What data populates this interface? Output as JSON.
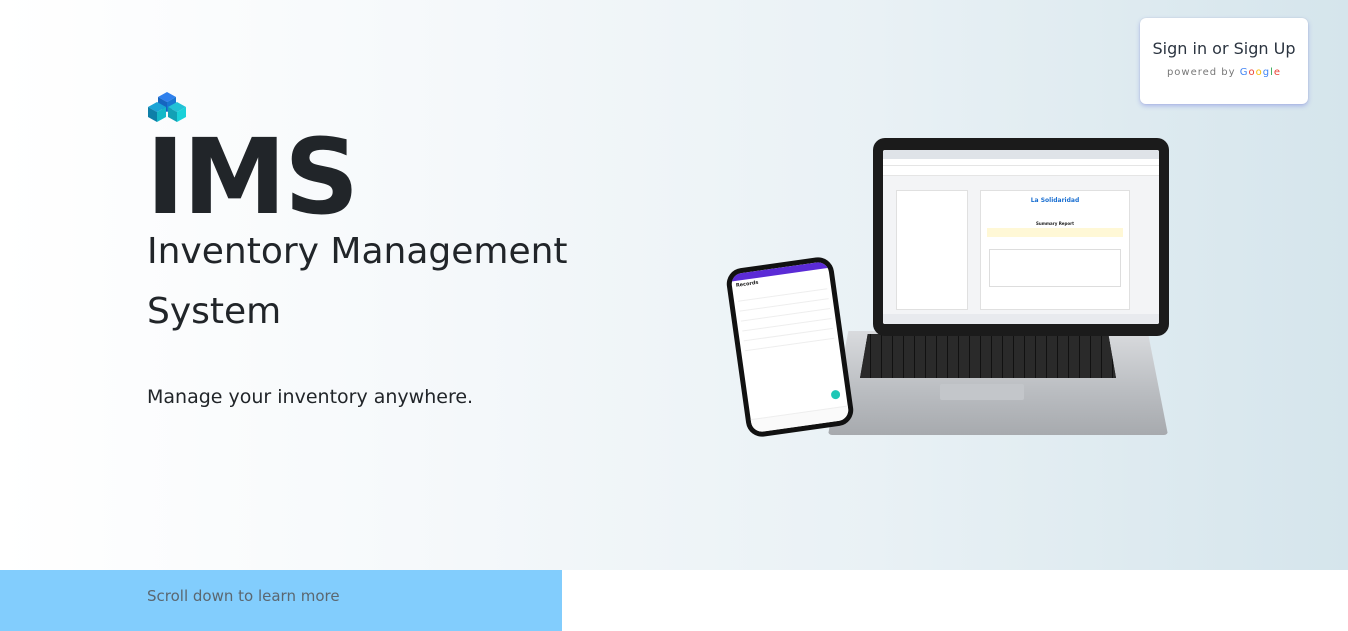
{
  "signin": {
    "label": "Sign in or Sign Up",
    "powered_by": "powered by",
    "google": [
      "G",
      "o",
      "o",
      "g",
      "l",
      "e"
    ]
  },
  "hero": {
    "logo_icon": "cubes-logo-icon",
    "title": "IMS",
    "subtitle": "Inventory Management System",
    "tagline": "Manage your inventory anywhere."
  },
  "devices": {
    "laptop_brand": "La Solidaridad",
    "laptop_report_title": "Summary Report",
    "phone_header": "Records"
  },
  "footer_banner": {
    "scroll_text": "Scroll down to learn more"
  },
  "colors": {
    "accent": "#82cdfd",
    "logo_blue": "#1565c0",
    "logo_cyan": "#14b8c8",
    "text_dark": "#212529"
  }
}
